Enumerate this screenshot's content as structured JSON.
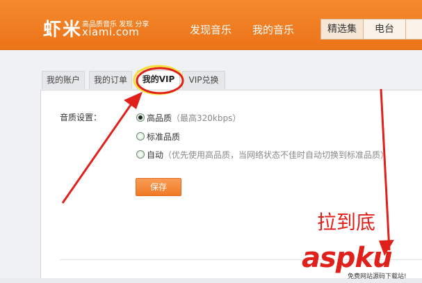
{
  "header": {
    "logo_cn": "虾米",
    "logo_slogan": "高品质音乐 发现 分享",
    "logo_domain": "xiami.com",
    "nav_links": [
      "发现音乐",
      "我的音乐"
    ],
    "nav_tabs": [
      "精选集",
      "电台"
    ]
  },
  "account_tabs": [
    "我的账户",
    "我的订单",
    "我的VIP",
    "VIP兑换"
  ],
  "active_tab": "我的VIP",
  "quality": {
    "label": "音质设置：",
    "options": [
      {
        "text": "高品质",
        "hint": "（最高320kbps）",
        "checked": true
      },
      {
        "text": "标准品质",
        "hint": "",
        "checked": false
      },
      {
        "text": "自动",
        "hint": "（优先使用高品质，当网络状态不佳时自动切换到标准品质）",
        "checked": false
      }
    ]
  },
  "save_label": "保存",
  "annotation": {
    "text": "拉到底",
    "color": "#e0201a"
  },
  "watermark": {
    "main": "aspku",
    "sub": "免费网站源码下载站!"
  },
  "colors": {
    "accent": "#f07a26",
    "annotation_red": "#e0201a",
    "highlight_yellow": "#f5e03a"
  }
}
